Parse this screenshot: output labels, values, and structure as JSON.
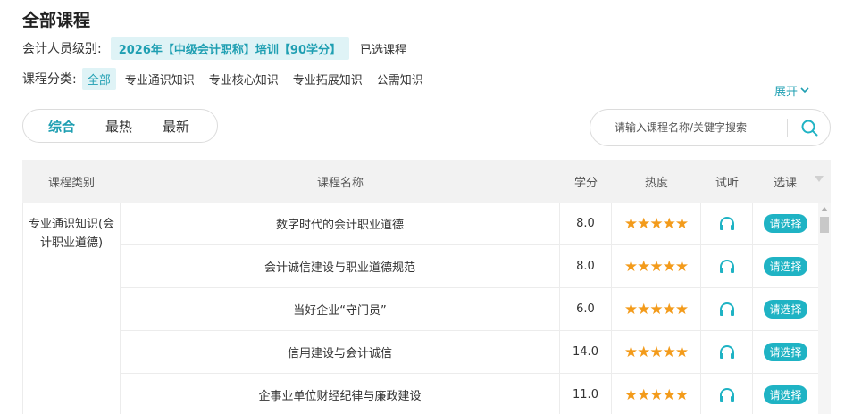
{
  "page": {
    "title": "全部课程"
  },
  "level": {
    "label": "会计人员级别:",
    "value": "2026年【中级会计职称】培训【90学分】",
    "selected_courses": "已选课程"
  },
  "categories": {
    "label": "课程分类:",
    "items": [
      "全部",
      "专业通识知识",
      "专业核心知识",
      "专业拓展知识",
      "公需知识"
    ],
    "active_index": 0,
    "expand_label": "展开"
  },
  "sort": {
    "items": [
      "综合",
      "最热",
      "最新"
    ],
    "active_index": 0
  },
  "search": {
    "placeholder": "请输入课程名称/关键字搜索"
  },
  "table": {
    "headers": [
      "课程类别",
      "课程名称",
      "学分",
      "热度",
      "试听",
      "选课"
    ],
    "category_cell": "专业通识知识(会计职业道德)",
    "rows": [
      {
        "name": "数字时代的会计职业道德",
        "credits": "8.0",
        "rating": 5,
        "action": "请选择"
      },
      {
        "name": "会计诚信建设与职业道德规范",
        "credits": "8.0",
        "rating": 5,
        "action": "请选择"
      },
      {
        "name": "当好企业“守门员”",
        "credits": "6.0",
        "rating": 5,
        "action": "请选择"
      },
      {
        "name": "信用建设与会计诚信",
        "credits": "14.0",
        "rating": 5,
        "action": "请选择"
      },
      {
        "name": "企事业单位财经纪律与廉政建设",
        "credits": "11.0",
        "rating": 5,
        "action": "请选择"
      }
    ]
  },
  "colors": {
    "accent": "#1fb3c4",
    "star": "#f39b1b",
    "pill_bg": "#dff3f6"
  }
}
